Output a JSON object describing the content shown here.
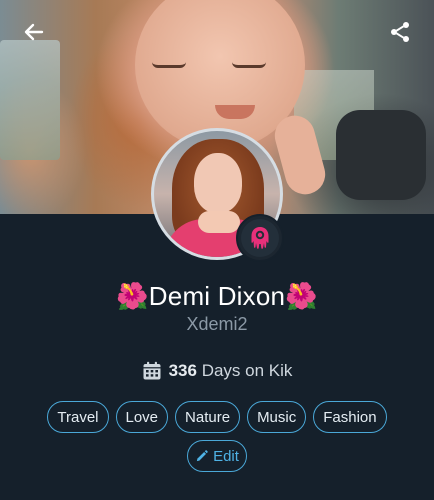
{
  "profile": {
    "display_name": "🌺Demi Dixon🌺",
    "username": "Xdemi2",
    "days_count": "336",
    "days_label": "Days on Kik"
  },
  "interests": [
    "Travel",
    "Love",
    "Nature",
    "Music",
    "Fashion"
  ],
  "actions": {
    "edit_label": "Edit"
  },
  "colors": {
    "background": "#15202b",
    "accent": "#4aa8d8",
    "bot_badge": "#e8307a"
  },
  "icons": {
    "back": "back-arrow-icon",
    "share": "share-icon",
    "calendar": "calendar-icon",
    "pencil": "pencil-icon",
    "bot": "kik-bot-icon"
  }
}
